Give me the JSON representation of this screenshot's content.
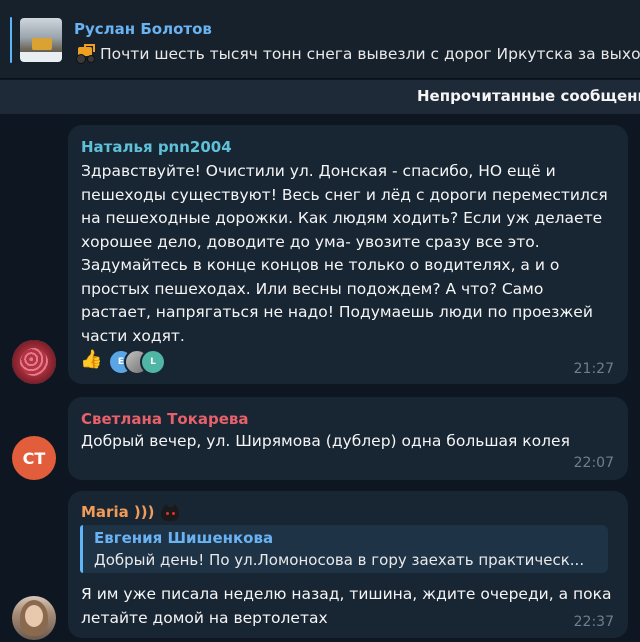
{
  "pinned": {
    "author": "Руслан Болотов",
    "text": "Почти шесть тысяч тонн снега вывезли с дорог Иркутска за выхо",
    "emoji_icon": "tractor-icon"
  },
  "unread_divider": "Непрочитанные сообщени",
  "messages": [
    {
      "author": "Наталья pnn2004",
      "author_color": "#5fc1d8",
      "text": "Здравствуйте! Очистили ул. Донская - спасибо, НО ещё и\nпешеходы существуют! Весь снег и лёд с дороги переместился\nна пешеходные дорожки. Как людям ходить? Если уж делаете\nхорошее дело, доводите до ума- увозите сразу все это.\nЗадумайтесь в конце концов не только о водителях, а и о\nпростых пешеходах. Или весны подождем? А что? Само\nрастает, напрягаться не надо! Подумаешь люди по проезжей\nчасти  ходят.",
      "time": "21:27",
      "reactions": {
        "emoji": "👍",
        "avatars": [
          "E",
          "",
          "L"
        ]
      }
    },
    {
      "author": "Светлана Токарева",
      "author_color": "#e8616a",
      "avatar_initials": "СТ",
      "text": "Добрый вечер, ул. Ширямова (дублер) одна большая колея",
      "time": "22:07"
    },
    {
      "author": "Maria )))",
      "author_color": "#f19b58",
      "reply": {
        "author": "Евгения Шишенкова",
        "text": "Добрый день! По ул.Ломоносова в гору заехать практическ..."
      },
      "text": "Я им уже писала неделю назад, тишина, ждите очереди, а пока\nлетайте домой на вертолетах",
      "time": "22:37"
    }
  ]
}
